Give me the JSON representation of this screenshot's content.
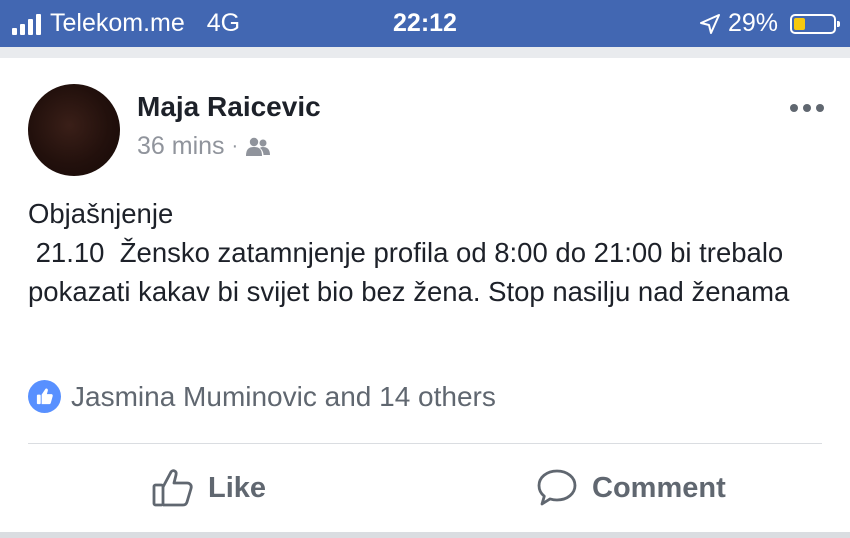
{
  "status_bar": {
    "carrier": "Telekom.me",
    "network": "4G",
    "time": "22:12",
    "battery_percent": "29%",
    "battery_level": 0.29,
    "battery_color": "#f7c90e",
    "background": "#4267b2"
  },
  "post": {
    "author": "Maja Raicevic",
    "time_ago": "36 mins",
    "separator": "·",
    "audience_icon": "friends-icon",
    "text": "Objašnjenje\n 21.10  Žensko zatamnjenje profila od 8:00 do 21:00 bi trebalo pokazati kakav bi svijet bio bez žena. Stop nasilju nad ženama",
    "reactions_text": "Jasmina Muminovic and 14 others",
    "reaction_icon": "like-icon"
  },
  "actions": {
    "like_label": "Like",
    "comment_label": "Comment"
  }
}
